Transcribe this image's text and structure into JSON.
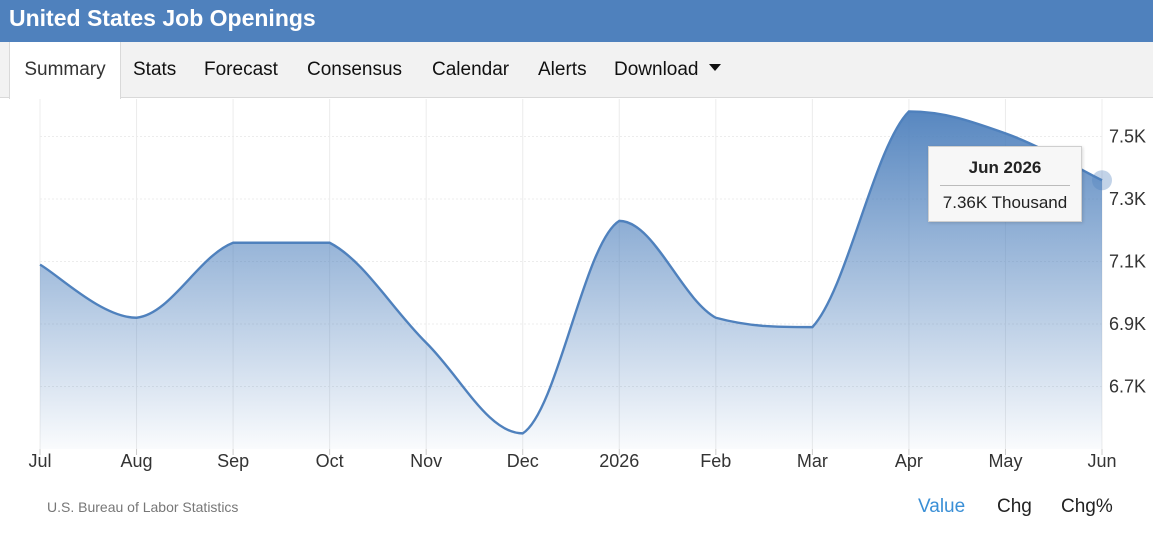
{
  "header": {
    "title": "United States Job Openings"
  },
  "tabs": [
    {
      "label": "Summary",
      "active": true
    },
    {
      "label": "Stats"
    },
    {
      "label": "Forecast"
    },
    {
      "label": "Consensus"
    },
    {
      "label": "Calendar"
    },
    {
      "label": "Alerts"
    },
    {
      "label": "Download"
    }
  ],
  "chart_data": {
    "type": "area",
    "categories": [
      "Jul",
      "Aug",
      "Sep",
      "Oct",
      "Nov",
      "Dec",
      "2026",
      "Feb",
      "Mar",
      "Apr",
      "May",
      "Jun"
    ],
    "series": [
      {
        "values": [
          7.09,
          6.92,
          7.16,
          7.16,
          6.84,
          6.55,
          7.23,
          6.92,
          6.89,
          7.58,
          7.51,
          7.36
        ]
      }
    ],
    "yticks": [
      "6.7K",
      "6.9K",
      "7.1K",
      "7.3K",
      "7.5K"
    ],
    "ytick_values": [
      6.7,
      6.9,
      7.1,
      7.3,
      7.5
    ],
    "ylim": [
      6.5,
      7.62
    ],
    "grid": true,
    "color": "#4f81bd",
    "tooltip": {
      "date": "Jun 2026",
      "value": "7.36K Thousand"
    }
  },
  "footer": {
    "source": "U.S. Bureau of Labor Statistics",
    "buttons": [
      {
        "label": "Value",
        "active": true
      },
      {
        "label": "Chg"
      },
      {
        "label": "Chg%"
      }
    ]
  }
}
